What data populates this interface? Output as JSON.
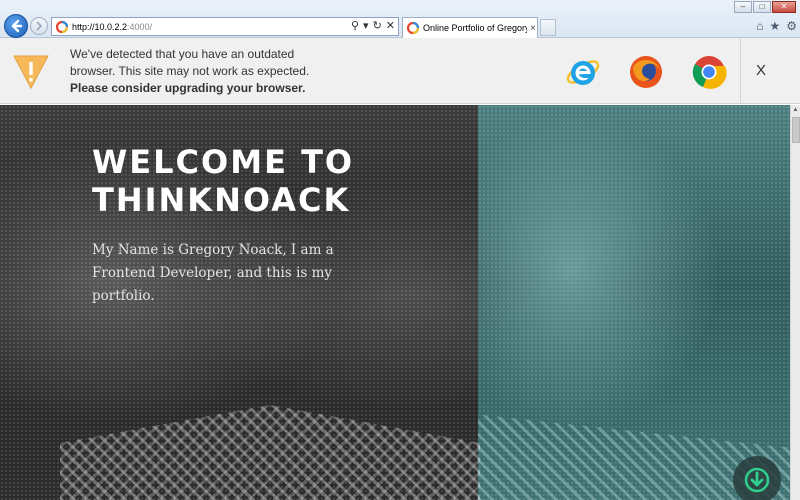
{
  "browser": {
    "url_host": "http://10.0.2.2",
    "url_rest": ":4000/",
    "tab_title": "Online Portfolio of Gregory...",
    "tab_close": "×",
    "address_tools": {
      "search": "⚲",
      "dropdown": "▾",
      "refresh": "↻",
      "stop": "✕"
    },
    "window_buttons": {
      "minimize": "–",
      "maximize": "□",
      "close": "✕"
    },
    "command_icons": {
      "home": "⌂",
      "favorites": "★",
      "tools": "⚙"
    }
  },
  "banner": {
    "line1": "We've detected that you have an outdated",
    "line2": "browser. This site may not work as expected.",
    "line3": "Please consider upgrading your browser.",
    "close_label": "X",
    "browsers": [
      "Internet Explorer",
      "Firefox",
      "Chrome"
    ]
  },
  "hero": {
    "title_line1": "WELCOME TO",
    "title_line2": "THINKNOACK",
    "intro": "My Name is Gregory Noack, I am a Frontend Developer, and this is my portfolio."
  },
  "colors": {
    "accent_green": "#2fcf8e",
    "ie_blue": "#1fa3e6",
    "warning_orange": "#f5b95a",
    "teal_panel": "#3e7273"
  }
}
